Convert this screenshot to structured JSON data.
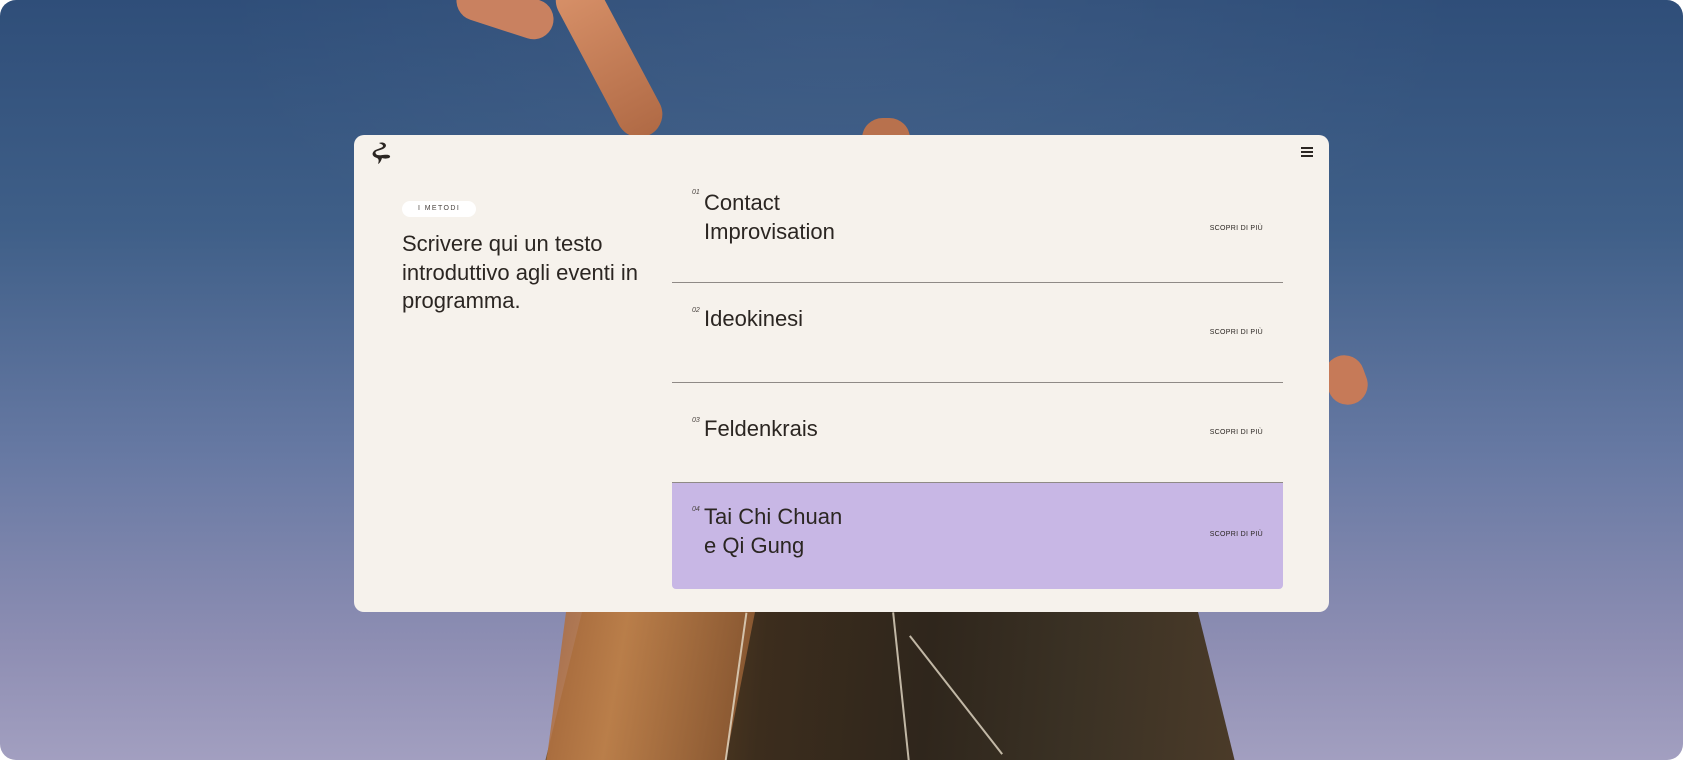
{
  "header": {
    "logo_icon": "swirl-logo-icon",
    "menu_icon": "hamburger-menu-icon"
  },
  "intro": {
    "tag": "I METODI",
    "text": "Scrivere qui un testo introduttivo agli eventi in programma."
  },
  "methods": [
    {
      "number": "01",
      "name": "Contact\nImprovisation",
      "link": "SCOPRI DI PIÙ",
      "active": false
    },
    {
      "number": "02",
      "name": "Ideokinesi",
      "link": "SCOPRI DI PIÙ",
      "active": false
    },
    {
      "number": "03",
      "name": "Feldenkrais",
      "link": "SCOPRI DI PIÙ",
      "active": false
    },
    {
      "number": "04",
      "name": "Tai Chi Chuan\ne Qi Gung",
      "link": "SCOPRI DI PIÙ",
      "active": true
    }
  ],
  "colors": {
    "card_background": "#f6f2ec",
    "active_item": "#c8b7e5",
    "text": "#2b2622"
  }
}
